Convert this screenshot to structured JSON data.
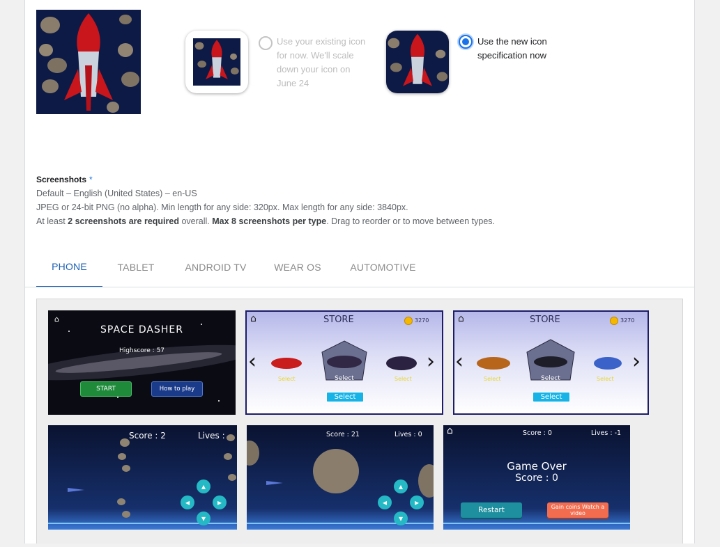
{
  "icon_options": {
    "old_label": "Use your existing icon for now. We'll scale down your icon on June 24",
    "new_label": "Use the new icon specification now",
    "selected": "new"
  },
  "screenshots": {
    "title": "Screenshots",
    "required_mark": "*",
    "language_line": "Default – English (United States) – en-US",
    "format_line": "JPEG or 24-bit PNG (no alpha). Min length for any side: 320px. Max length for any side: 3840px.",
    "req_prefix": "At least",
    "req_bold1": "2 screenshots are required",
    "req_mid": "overall.",
    "req_bold2": "Max 8 screenshots per type",
    "req_suffix": ". Drag to reorder or to move between types."
  },
  "tabs": [
    {
      "label": "PHONE",
      "active": true
    },
    {
      "label": "TABLET",
      "active": false
    },
    {
      "label": "ANDROID TV",
      "active": false
    },
    {
      "label": "WEAR OS",
      "active": false
    },
    {
      "label": "AUTOMOTIVE",
      "active": false
    }
  ],
  "gallery": {
    "s1": {
      "title": "SPACE DASHER",
      "highscore": "Highscore : 57",
      "start": "START",
      "howto": "How to play"
    },
    "s2": {
      "title": "STORE",
      "coins": "3270",
      "select_center": "Select",
      "select_btn": "Select",
      "left_label": "Select",
      "right_label": "Select"
    },
    "s3": {
      "title": "STORE",
      "coins": "3270",
      "select_center": "Select",
      "select_btn": "Select",
      "left_label": "Select",
      "right_label": "Select"
    },
    "s4": {
      "score": "Score : 2",
      "lives": "Lives :"
    },
    "s5": {
      "score": "Score : 21",
      "lives": "Lives : 0"
    },
    "s6": {
      "score": "Score : 0",
      "lives": "Lives : -1",
      "game_over": "Game Over",
      "final_score": "Score : 0",
      "restart": "Restart",
      "gain": "Gain coins Watch a video"
    }
  },
  "colors": {
    "accent": "#1a73e8",
    "tab_active": "#1a5fb4",
    "space_bg": "#0d1a45"
  },
  "icons": [
    "app-icon-rocket",
    "home-icon",
    "coin-icon",
    "chevron-left-icon",
    "chevron-right-icon",
    "dpad-up-icon",
    "dpad-down-icon",
    "dpad-left-icon",
    "dpad-right-icon"
  ]
}
